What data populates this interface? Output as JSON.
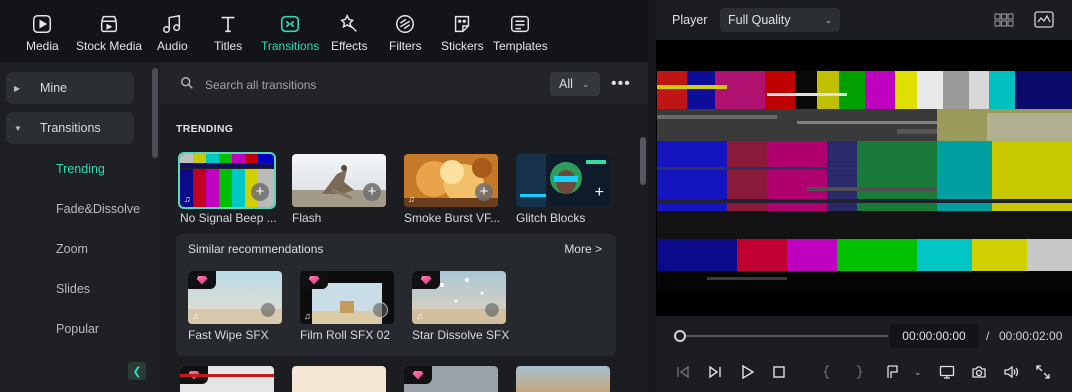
{
  "toolbar": {
    "tools": [
      {
        "label": "Media",
        "icon": "media-icon"
      },
      {
        "label": "Stock Media",
        "icon": "stock-media-icon"
      },
      {
        "label": "Audio",
        "icon": "audio-icon"
      },
      {
        "label": "Titles",
        "icon": "titles-icon"
      },
      {
        "label": "Transitions",
        "icon": "transitions-icon",
        "active": true
      },
      {
        "label": "Effects",
        "icon": "effects-icon"
      },
      {
        "label": "Filters",
        "icon": "filters-icon"
      },
      {
        "label": "Stickers",
        "icon": "stickers-icon"
      },
      {
        "label": "Templates",
        "icon": "templates-icon"
      }
    ],
    "accent_color": "#2fd8b8"
  },
  "sidebar": {
    "groups": [
      {
        "label": "Mine",
        "expanded": false
      },
      {
        "label": "Transitions",
        "expanded": true
      }
    ],
    "items": [
      {
        "label": "Trending",
        "active": true
      },
      {
        "label": "Fade&Dissolve"
      },
      {
        "label": "Zoom"
      },
      {
        "label": "Slides"
      },
      {
        "label": "Popular"
      }
    ]
  },
  "search": {
    "placeholder": "Search all transitions",
    "filter_value": "All"
  },
  "trending": {
    "title": "TRENDING",
    "cards": [
      {
        "name": "No Signal Beep ...",
        "selected": true
      },
      {
        "name": "Flash"
      },
      {
        "name": "Smoke Burst VF..."
      },
      {
        "name": "Glitch Blocks"
      }
    ]
  },
  "similar": {
    "title": "Similar recommendations",
    "more_label": "More >",
    "cards": [
      {
        "name": "Fast Wipe SFX",
        "premium": true
      },
      {
        "name": "Film Roll SFX 02",
        "premium": true
      },
      {
        "name": "Star Dissolve SFX",
        "premium": true
      }
    ]
  },
  "player": {
    "label": "Player",
    "quality": "Full Quality",
    "current_time": "00:00:00:00",
    "separator": "/",
    "total_time": "00:00:02:00",
    "progress": 0.0
  }
}
